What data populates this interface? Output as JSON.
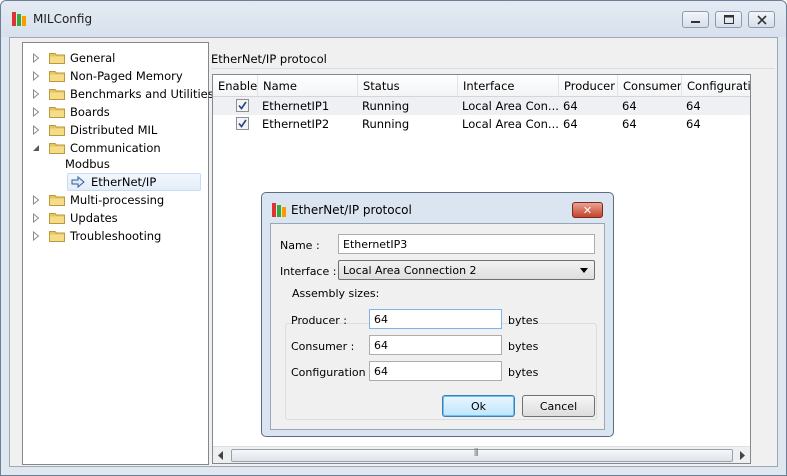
{
  "window": {
    "title": "MILConfig"
  },
  "tree": {
    "items": [
      {
        "label": "General",
        "expanded": false
      },
      {
        "label": "Non-Paged Memory",
        "expanded": false
      },
      {
        "label": "Benchmarks and Utilities",
        "expanded": false
      },
      {
        "label": "Boards",
        "expanded": false
      },
      {
        "label": "Distributed MIL",
        "expanded": false
      },
      {
        "label": "Communication",
        "expanded": true
      },
      {
        "label": "Modbus"
      },
      {
        "label": "EtherNet/IP",
        "selected": true
      },
      {
        "label": "Multi-processing",
        "expanded": false
      },
      {
        "label": "Updates",
        "expanded": false
      },
      {
        "label": "Troubleshooting",
        "expanded": false
      }
    ]
  },
  "panel": {
    "group_title": "EtherNet/IP protocol",
    "columns": [
      "Enable",
      "Name",
      "Status",
      "Interface",
      "Producer",
      "Consumer",
      "Configuratic"
    ],
    "rows": [
      {
        "enabled": true,
        "name": "EthernetIP1",
        "status": "Running",
        "interface": "Local Area Con...",
        "producer": "64",
        "consumer": "64",
        "configuration": "64"
      },
      {
        "enabled": true,
        "name": "EthernetIP2",
        "status": "Running",
        "interface": "Local Area Con...",
        "producer": "64",
        "consumer": "64",
        "configuration": "64"
      }
    ],
    "scroll_grip": "⦀"
  },
  "dialog": {
    "title": "EtherNet/IP protocol",
    "close_label": "✕",
    "name_label": "Name :",
    "name_value": "EthernetIP3",
    "interface_label": "Interface :",
    "interface_value": "Local Area Connection 2",
    "assembly_label": "Assembly sizes:",
    "producer_label": "Producer :",
    "producer_value": "64",
    "consumer_label": "Consumer :",
    "consumer_value": "64",
    "configuration_label": "Configuration :",
    "configuration_value": "64",
    "unit": "bytes",
    "ok_label": "Ok",
    "cancel_label": "Cancel"
  },
  "colors": {
    "folder": "#e8c45c",
    "selection": "#e3edf9",
    "accent": "#3c7fb1"
  }
}
